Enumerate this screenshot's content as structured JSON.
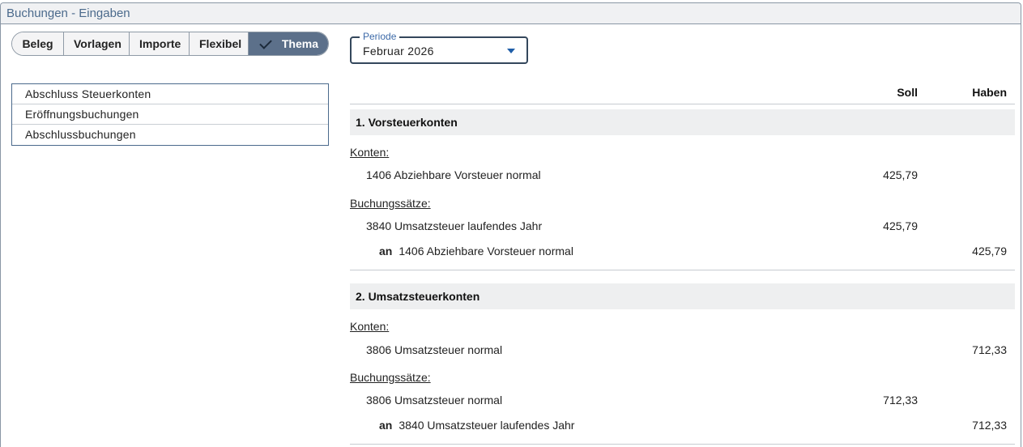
{
  "window": {
    "title": "Buchungen - Eingaben"
  },
  "tabs": [
    {
      "label": "Beleg"
    },
    {
      "label": "Vorlagen"
    },
    {
      "label": "Importe"
    },
    {
      "label": "Flexibel"
    },
    {
      "label": "Thema",
      "selected": true,
      "icon": "check-icon"
    }
  ],
  "topics": [
    {
      "label": "Abschluss Steuerkonten"
    },
    {
      "label": "Eröffnungsbuchungen"
    },
    {
      "label": "Abschlussbuchungen"
    }
  ],
  "period": {
    "label": "Periode",
    "value": "Februar 2026"
  },
  "report": {
    "col_soll": "Soll",
    "col_haben": "Haben",
    "sections": [
      {
        "title": "1. Vorsteuerkonten",
        "konten_label": "Konten:",
        "konten": [
          {
            "text": "1406 Abziehbare Vorsteuer normal",
            "soll": "425,79",
            "haben": ""
          }
        ],
        "buchungen_label": "Buchungssätze:",
        "buchungen": [
          {
            "an": "",
            "text": "3840 Umsatzsteuer laufendes Jahr",
            "soll": "425,79",
            "haben": ""
          },
          {
            "an": "an",
            "text": "1406 Abziehbare Vorsteuer normal",
            "soll": "",
            "haben": "425,79"
          }
        ]
      },
      {
        "title": "2. Umsatzsteuerkonten",
        "konten_label": "Konten:",
        "konten": [
          {
            "text": "3806 Umsatzsteuer normal",
            "soll": "",
            "haben": "712,33"
          }
        ],
        "buchungen_label": "Buchungssätze:",
        "buchungen": [
          {
            "an": "",
            "text": "3806 Umsatzsteuer normal",
            "soll": "712,33",
            "haben": ""
          },
          {
            "an": "an",
            "text": "3840 Umsatzsteuer laufendes Jahr",
            "soll": "",
            "haben": "712,33"
          }
        ]
      }
    ]
  }
}
